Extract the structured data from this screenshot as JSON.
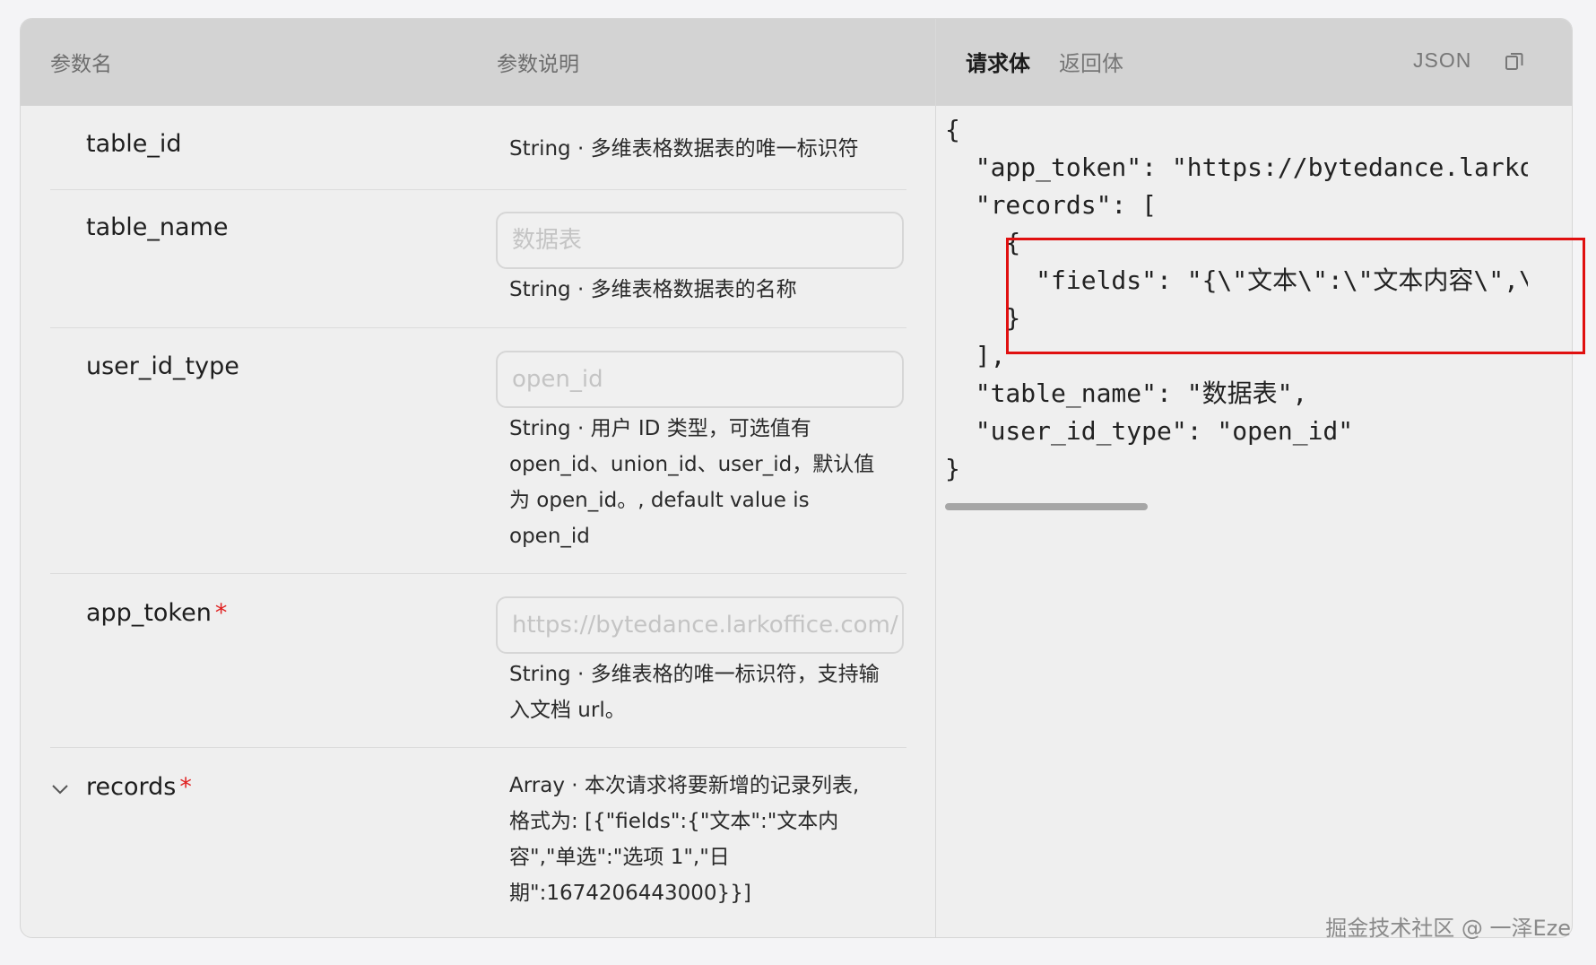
{
  "header": {
    "param_name_label": "参数名",
    "param_desc_label": "参数说明",
    "tab_request": "请求体",
    "tab_response": "返回体",
    "format_label": "JSON"
  },
  "params": [
    {
      "name": "table_id",
      "required": false,
      "input_placeholder": null,
      "description": "String · 多维表格数据表的唯一标识符"
    },
    {
      "name": "table_name",
      "required": false,
      "input_placeholder": "数据表",
      "description": "String · 多维表格数据表的名称"
    },
    {
      "name": "user_id_type",
      "required": false,
      "input_placeholder": "open_id",
      "description_lines": [
        "String · 用户 ID 类型，可选值有",
        "open_id、union_id、user_id，默认值",
        "为 open_id。, default value is",
        "open_id"
      ]
    },
    {
      "name": "app_token",
      "required": true,
      "input_placeholder": "https://bytedance.larkoffice.com/",
      "description_lines": [
        "String · 多维表格的唯一标识符，支持输",
        "入文档 url。"
      ]
    },
    {
      "name": "records",
      "required": true,
      "expandable": true,
      "description_lines": [
        "Array · 本次请求将要新增的记录列表,",
        "格式为: [{\"fields\":{\"文本\":\"文本内",
        "容\",\"单选\":\"选项 1\",\"日",
        "期\":1674206443000}}]"
      ]
    }
  ],
  "required_mark": "*",
  "code_lines": [
    "{",
    "  \"app_token\": \"https://bytedance.larko",
    "  \"records\": [",
    "    {",
    "      \"fields\": \"{\\\"文本\\\":\\\"文本内容\\\",\\",
    "    }",
    "  ],",
    "  \"table_name\": \"数据表\",",
    "  \"user_id_type\": \"open_id\"",
    "}"
  ],
  "watermark": "掘金技术社区 @ 一泽Eze",
  "colors": {
    "highlight": "#e01010",
    "required": "#e02020"
  },
  "icons": {
    "copy": "copy-icon",
    "expand": "chevron-down-icon"
  }
}
